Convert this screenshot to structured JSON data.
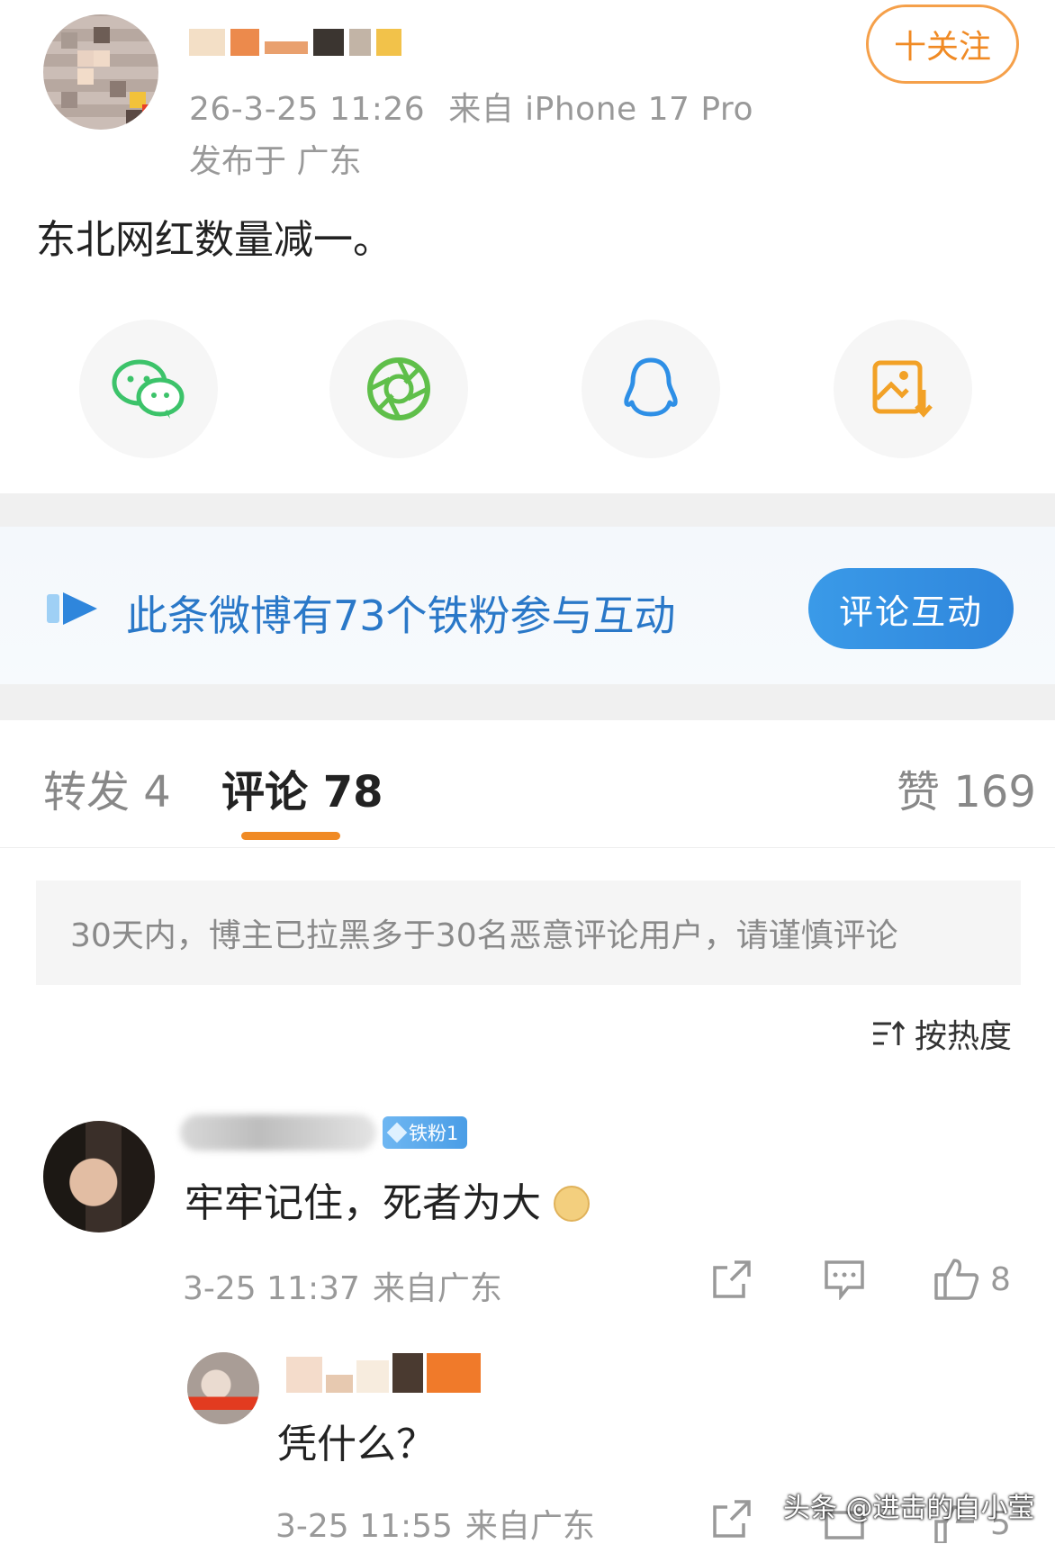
{
  "post": {
    "meta_time": "26-3-25 11:26",
    "meta_source": "来自 iPhone 17 Pro",
    "location": "发布于 广东",
    "follow_label": "十关注",
    "text": "东北网红数量减一。"
  },
  "share": {
    "items": [
      {
        "name": "wechat",
        "icon": "wechat-icon"
      },
      {
        "name": "moments",
        "icon": "moments-shutter-icon"
      },
      {
        "name": "qq",
        "icon": "qq-penguin-icon"
      },
      {
        "name": "save-image",
        "icon": "save-image-icon"
      }
    ]
  },
  "fans_banner": {
    "text": "此条微博有73个铁粉参与互动",
    "button_label": "评论互动"
  },
  "tabs": {
    "repost": "转发 4",
    "comments": "评论 78",
    "likes": "赞 169"
  },
  "notice": "30天内，博主已拉黑多于30名恶意评论用户，请谨慎评论",
  "sort_label": "按热度",
  "comments": [
    {
      "badge": "铁粉1",
      "text": "牢牢记住，死者为大",
      "time": "3-25 11:37",
      "location": "来自广东",
      "like_count": "8"
    },
    {
      "text": "凭什么？",
      "time": "3-25 11:55",
      "location": "来自广东",
      "like_count": "5"
    }
  ],
  "watermark": "头条 @进击的白小莹",
  "colors": {
    "accent_orange": "#f08a24",
    "link_blue": "#2a78c8",
    "button_blue": "#2f86dc",
    "meta_gray": "#999999"
  }
}
